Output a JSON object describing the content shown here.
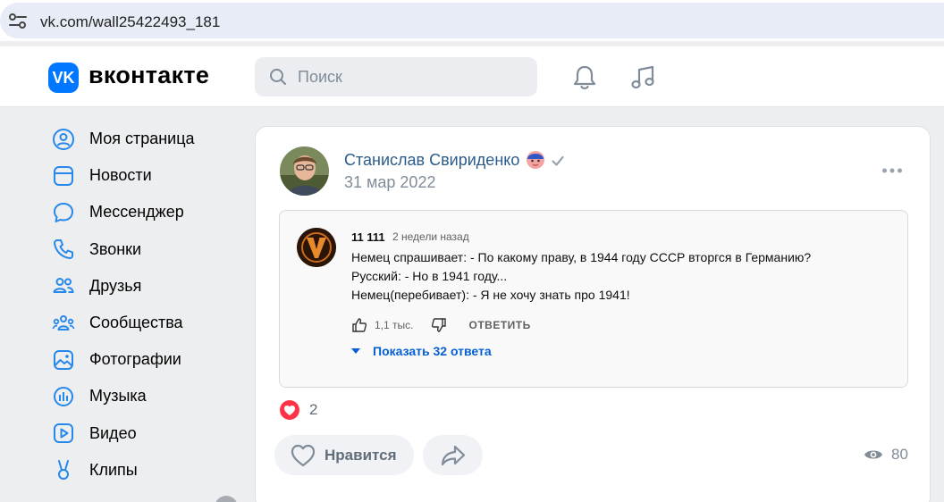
{
  "browser": {
    "url": "vk.com/wall25422493_181"
  },
  "header": {
    "logo_text": "VK",
    "brand": "вконтакте",
    "search": {
      "placeholder": "Поиск",
      "value": ""
    },
    "icons": [
      "bell-icon",
      "music-note-icon"
    ]
  },
  "sidebar": {
    "items": [
      {
        "label": "Моя страница",
        "icon": "user-circle-icon"
      },
      {
        "label": "Новости",
        "icon": "news-icon"
      },
      {
        "label": "Мессенджер",
        "icon": "message-bubble-icon"
      },
      {
        "label": "Звонки",
        "icon": "phone-icon"
      },
      {
        "label": "Друзья",
        "icon": "friends-icon"
      },
      {
        "label": "Сообщества",
        "icon": "communities-icon"
      },
      {
        "label": "Фотографии",
        "icon": "photo-icon"
      },
      {
        "label": "Музыка",
        "icon": "music-icon"
      },
      {
        "label": "Видео",
        "icon": "video-icon"
      },
      {
        "label": "Клипы",
        "icon": "clips-icon"
      }
    ]
  },
  "post": {
    "author": "Станислав Свириденко",
    "date": "31 мар 2022",
    "embedded_comment": {
      "author": "11 111",
      "when": "2 недели назад",
      "lines": [
        "Немец спрашивает: - По какому праву, в 1944 году СССР вторгся в Германию?",
        "Русский: - Но в 1941 году...",
        "Немец(перебивает): - Я не хочу знать про 1941!"
      ],
      "likes": "1,1 тыс.",
      "reply_label": "ОТВЕТИТЬ",
      "show_replies": "Показать 32 ответа"
    },
    "reactions_count": "2",
    "like_label": "Нравится",
    "views": "80"
  },
  "colors": {
    "accent": "#0077ff",
    "link": "#2c5b8a",
    "reaction": "#ff3347",
    "yt_link": "#065fd4",
    "page_bg": "#edeef0"
  }
}
